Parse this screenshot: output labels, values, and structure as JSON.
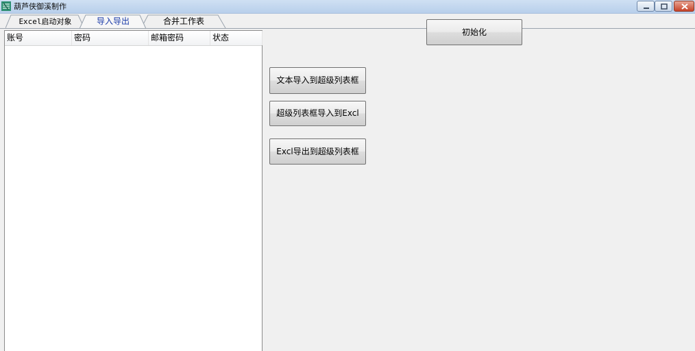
{
  "window": {
    "title": "葫芦侠御溪制作",
    "controls": {
      "minimize_icon": "minimize-icon",
      "maximize_icon": "maximize-icon",
      "close_icon": "close-icon"
    }
  },
  "tabs": [
    {
      "label": "Excel启动对象",
      "active": false
    },
    {
      "label": "导入导出",
      "active": true
    },
    {
      "label": "合并工作表",
      "active": false
    }
  ],
  "listview": {
    "columns": [
      "账号",
      "密码",
      "邮箱密码",
      "状态"
    ],
    "rows": []
  },
  "buttons": {
    "init": "初始化",
    "text_import": "文本导入到超级列表框",
    "list_to_excel": "超级列表框导入到Excl",
    "excel_to_list": "Excl导出到超级列表框"
  },
  "colors": {
    "active_tab_text": "#1a3aa8",
    "titlebar": "#c5d9f1",
    "close_button": "#c7442a"
  }
}
